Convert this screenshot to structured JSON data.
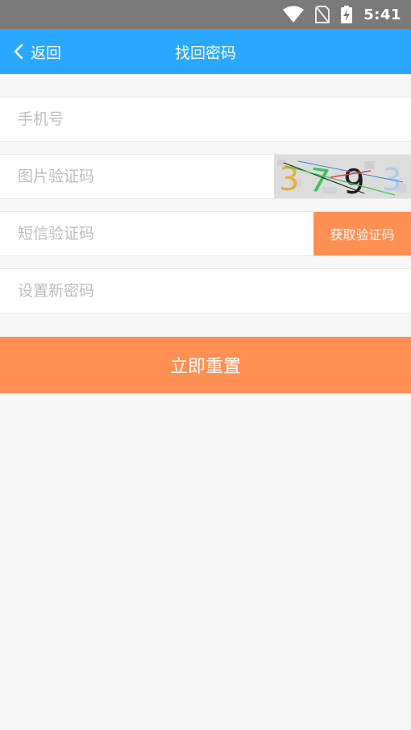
{
  "status_bar": {
    "time": "5:41",
    "icons": [
      "wifi-icon",
      "no-sim-icon",
      "battery-charging-icon"
    ]
  },
  "nav": {
    "back_label": "返回",
    "title": "找回密码"
  },
  "form": {
    "phone_placeholder": "手机号",
    "captcha_placeholder": "图片验证码",
    "captcha_code": "3793",
    "sms_placeholder": "短信验证码",
    "sms_button_label": "获取验证码",
    "password_placeholder": "设置新密码"
  },
  "submit_label": "立即重置",
  "colors": {
    "header": "#2aa7ff",
    "accent": "#ff8f52",
    "background": "#f7f7f7"
  }
}
